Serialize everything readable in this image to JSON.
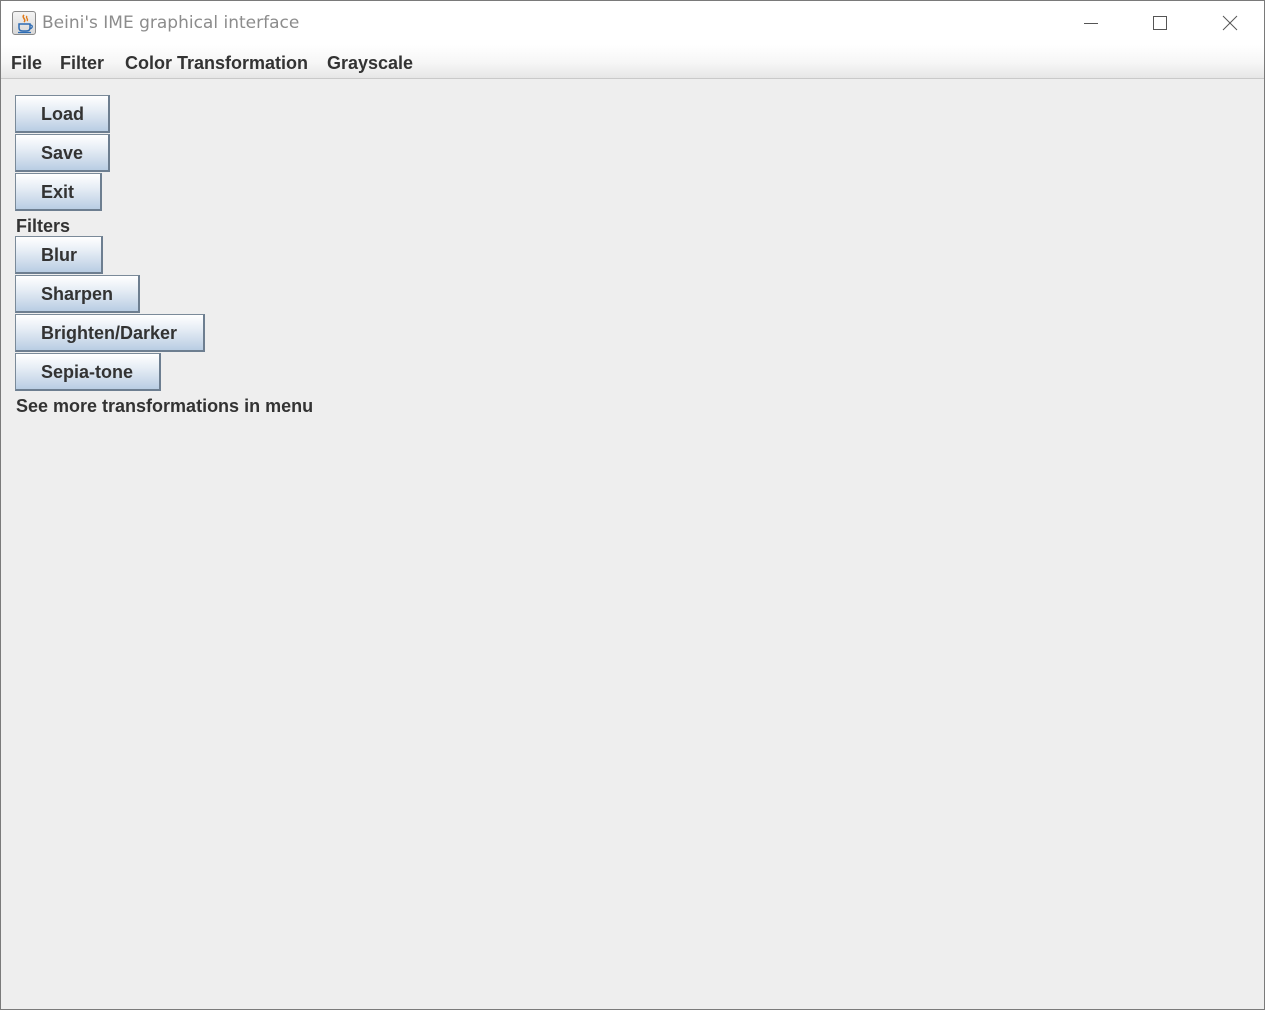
{
  "window": {
    "title": "Beini's IME graphical interface",
    "controls": {
      "minimize_icon": "minimize-icon",
      "maximize_icon": "maximize-icon",
      "close_icon": "close-icon"
    },
    "app_icon": "java-coffee-cup-icon"
  },
  "menubar": {
    "items": [
      "File",
      "Filter",
      "Color Transformation",
      "Grayscale"
    ]
  },
  "buttons": {
    "load": "Load",
    "save": "Save",
    "exit": "Exit",
    "blur": "Blur",
    "sharpen": "Sharpen",
    "brighten_darker": "Brighten/Darker",
    "sepia_tone": "Sepia-tone"
  },
  "labels": {
    "filters": "Filters",
    "more_hint": "See more transformations in menu"
  },
  "colors": {
    "background": "#eeeeee",
    "button_gradient_top": "#ffffff",
    "button_gradient_bottom": "#b9cde3",
    "text": "#333333",
    "title_text": "#8c8c8c"
  }
}
